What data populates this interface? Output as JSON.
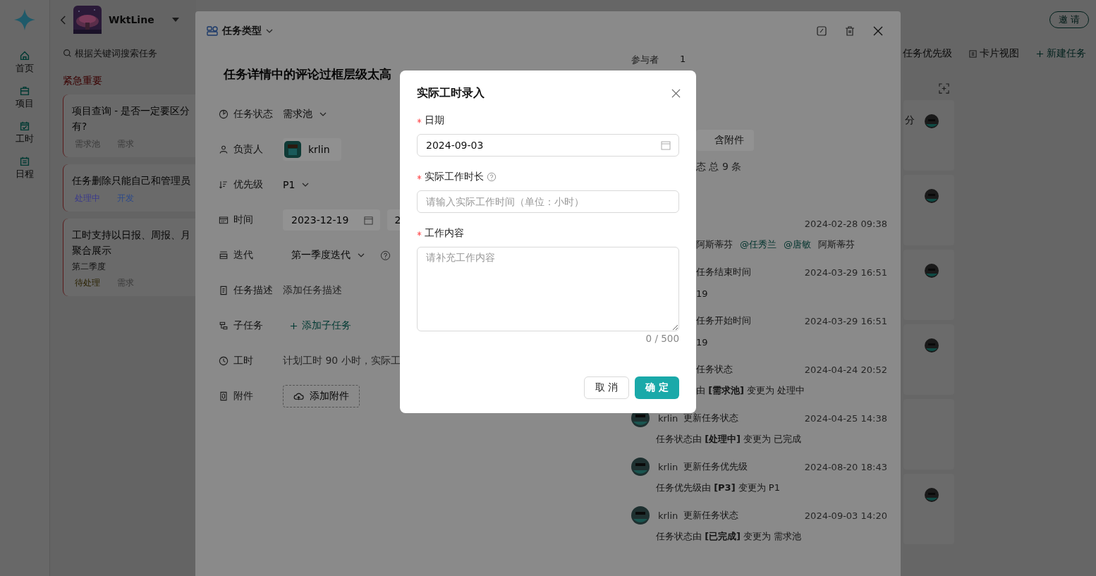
{
  "nav": [
    {
      "label": "首页"
    },
    {
      "label": "项目"
    },
    {
      "label": "工时"
    },
    {
      "label": "日程"
    }
  ],
  "project": {
    "name": "WktLine"
  },
  "search": {
    "placeholder": "根据关键词搜索任务"
  },
  "group": {
    "title": "紧急重要",
    "cards": [
      {
        "title_lines": [
          "项目查询 - 是否一定要区分",
          "有?"
        ],
        "tags": [
          {
            "label": "需求池",
            "color": "#3a3a3a"
          },
          {
            "label": "需求",
            "color": "#3a3a3a"
          }
        ]
      },
      {
        "title_lines": [
          "任务删除只能自己和管理员"
        ],
        "tags": [
          {
            "label": "处理中",
            "color": "#3b3a8c"
          },
          {
            "label": "开发",
            "color": "#2d4a8a"
          }
        ]
      },
      {
        "title_lines": [
          "工时支持以日报、周报、月",
          "聚合展示"
        ],
        "subtitle": "第二季度",
        "tags": [
          {
            "label": "待处理",
            "color": "#2a2200"
          },
          {
            "label": "需求",
            "color": "#3a3a3a"
          }
        ]
      }
    ]
  },
  "invite_button": "邀 请",
  "toolbar": [
    {
      "kind": "text",
      "label": "任务优先级"
    },
    {
      "kind": "view",
      "label": "卡片视图"
    },
    {
      "kind": "add",
      "label": "新建任务"
    }
  ],
  "board_cards": [
    {
      "text": "分",
      "avatar": true
    },
    {
      "avatar": true
    },
    {
      "avatar": true
    },
    {
      "avatar": true
    },
    {
      "avatar": false
    },
    {
      "avatar": true
    }
  ],
  "drawer": {
    "type_label": "任务类型",
    "title": "任务详情中的评论过框层级太高",
    "fields": [
      {
        "kind": "select",
        "label": "任务状态",
        "value": "需求池"
      },
      {
        "kind": "user",
        "label": "负责人",
        "value": "krlin"
      },
      {
        "kind": "select",
        "label": "优先级",
        "value": "P1"
      },
      {
        "kind": "date",
        "label": "时间",
        "value": "2023-12-19",
        "value_2": "2"
      },
      {
        "kind": "iteration",
        "label": "迭代",
        "value": "第一季度迭代"
      },
      {
        "kind": "placeholder",
        "label": "任务描述",
        "value": "添加任务描述"
      },
      {
        "kind": "link",
        "label": "子任务",
        "value": "添加子任务"
      },
      {
        "kind": "muted",
        "label": "工时",
        "value": "计划工时 90 小时，实际工"
      },
      {
        "kind": "upload",
        "label": "附件",
        "value": "添加附件"
      }
    ],
    "participants": {
      "label": "参与者",
      "value": "1"
    },
    "filter_tab": "含附件",
    "summary": "态 总 9 条",
    "activities": [
      {
        "kind": "comment",
        "time": "2024-02-28 09:38",
        "parts": [
          {
            "text": "阿斯蒂芬",
            "mention": false
          },
          {
            "text": "@任秀兰",
            "mention": true
          },
          {
            "text": "@唐敏",
            "mention": true
          },
          {
            "text": "阿斯蒂芬",
            "mention": false
          }
        ]
      },
      {
        "kind": "cut",
        "action": "任务结束时间",
        "time": "2024-03-29 16:51",
        "detail": "19"
      },
      {
        "kind": "cut",
        "action": "任务开始时间",
        "time": "2024-03-29 16:51",
        "detail": "19"
      },
      {
        "kind": "cut",
        "action": "任务状态",
        "time": "2024-04-24 20:52",
        "detail": "由 **[需求池]** 变更为 处理中"
      },
      {
        "kind": "full",
        "user": "krlin",
        "action": "更新任务状态",
        "time": "2024-04-25 14:38",
        "detail": "任务状态由 **[处理中]** 变更为 已完成"
      },
      {
        "kind": "full",
        "user": "krlin",
        "action": "更新任务优先级",
        "time": "2024-08-20 18:43",
        "detail": "任务优先级由 **[P3]** 变更为 P1"
      },
      {
        "kind": "full",
        "user": "krlin",
        "action": "更新任务状态",
        "time": "2024-09-03 14:20",
        "detail": "任务状态由 **[已完成]** 变更为 需求池"
      }
    ]
  },
  "modal": {
    "title": "实际工时录入",
    "fields": [
      {
        "kind": "date",
        "required": true,
        "label": "日期",
        "value": "2024-09-03"
      },
      {
        "kind": "input",
        "required": true,
        "help": true,
        "label": "实际工作时长",
        "placeholder": "请输入实际工作时间（单位：小时）"
      },
      {
        "kind": "textarea",
        "required": true,
        "label": "工作内容",
        "placeholder": "请补充工作内容",
        "counter": "0 / 500"
      }
    ],
    "cancel_button": "取 消",
    "ok_button": "确 定"
  }
}
